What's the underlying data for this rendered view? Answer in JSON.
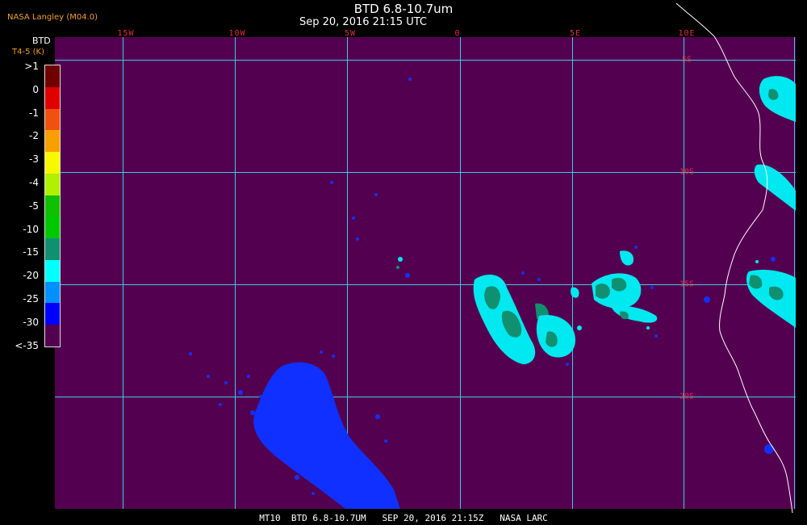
{
  "header": {
    "title": "BTD 6.8-10.7um",
    "subtitle": "Sep 20, 2016 21:15 UTC",
    "producer": "NASA Langley (M04.0)"
  },
  "map": {
    "background_color": "#540050",
    "grid_color": "#3cc8e8",
    "lon_labels": [
      "15W",
      "10W",
      "5W",
      "0",
      "5E",
      "10E"
    ],
    "lat_labels": [
      "5S",
      "10S",
      "15S",
      "20S"
    ]
  },
  "legend": {
    "title": "BTD",
    "units": "T4-5 (K)",
    "ticks": [
      ">1",
      "0",
      "-1",
      "-2",
      "-3",
      "-4",
      "-5",
      "-10",
      "-15",
      "-20",
      "-25",
      "-30",
      "<-35"
    ],
    "colors": [
      "#700000",
      "#e00000",
      "#f05010",
      "#f8a000",
      "#f8f800",
      "#b0f000",
      "#10c000",
      "#00c800",
      "#109070",
      "#00ffff",
      "#0090ff",
      "#0000ff",
      "#540050"
    ]
  },
  "footer": {
    "text": "MT10  BTD 6.8-10.7UM   SEP 20, 2016 21:15Z   NASA LARC"
  }
}
